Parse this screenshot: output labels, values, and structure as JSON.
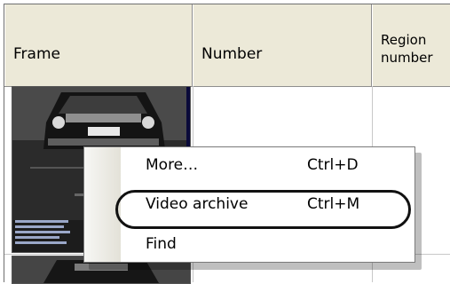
{
  "table": {
    "columns": [
      "Frame",
      "Number",
      "Region\nnumber"
    ]
  },
  "context_menu": {
    "items": [
      {
        "label": "More…",
        "shortcut": "Ctrl+D"
      },
      {
        "label": "Video archive",
        "shortcut": "Ctrl+M"
      },
      {
        "label": "Find",
        "shortcut": ""
      }
    ]
  }
}
